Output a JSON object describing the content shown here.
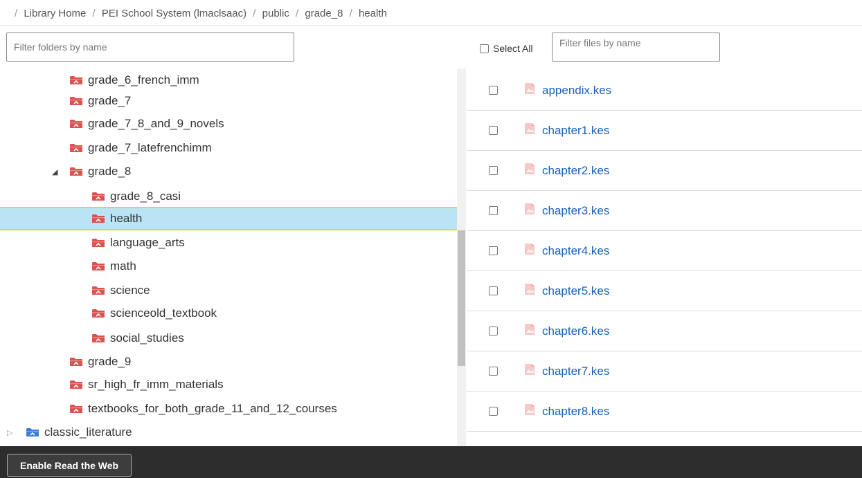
{
  "breadcrumb": {
    "items": [
      "Library Home",
      "PEI School System (lmaclsaac)",
      "public",
      "grade_8",
      "health"
    ],
    "separator": "/"
  },
  "folder_filter": {
    "placeholder": "Filter folders by name",
    "value": ""
  },
  "select_all": {
    "label": "Select All",
    "checked": false
  },
  "file_filter": {
    "placeholder": "Filter files by name",
    "value": ""
  },
  "folder_tree": [
    {
      "label": "grade_6_french_imm",
      "icon": "red-folder-icon"
    },
    {
      "label": "grade_7",
      "icon": "red-folder-icon"
    },
    {
      "label": "grade_7_8_and_9_novels",
      "icon": "red-folder-icon"
    },
    {
      "label": "grade_7_latefrenchimm",
      "icon": "red-folder-icon"
    },
    {
      "label": "grade_8",
      "icon": "red-folder-icon",
      "expanded": true
    },
    {
      "label": "grade_8_casi",
      "icon": "red-folder-icon"
    },
    {
      "label": "health",
      "icon": "red-folder-icon",
      "selected": true
    },
    {
      "label": "language_arts",
      "icon": "red-folder-icon"
    },
    {
      "label": "math",
      "icon": "red-folder-icon"
    },
    {
      "label": "science",
      "icon": "red-folder-icon"
    },
    {
      "label": "scienceold_textbook",
      "icon": "red-folder-icon"
    },
    {
      "label": "social_studies",
      "icon": "red-folder-icon"
    },
    {
      "label": "grade_9",
      "icon": "red-folder-icon"
    },
    {
      "label": "sr_high_fr_imm_materials",
      "icon": "red-folder-icon"
    },
    {
      "label": "textbooks_for_both_grade_11_and_12_courses",
      "icon": "red-folder-icon"
    },
    {
      "label": "classic_literature",
      "icon": "blue-folder-icon",
      "expanded": false
    }
  ],
  "files": [
    {
      "name": "appendix.kes",
      "checked": false
    },
    {
      "name": "chapter1.kes",
      "checked": false
    },
    {
      "name": "chapter2.kes",
      "checked": false
    },
    {
      "name": "chapter3.kes",
      "checked": false
    },
    {
      "name": "chapter4.kes",
      "checked": false
    },
    {
      "name": "chapter5.kes",
      "checked": false
    },
    {
      "name": "chapter6.kes",
      "checked": false
    },
    {
      "name": "chapter7.kes",
      "checked": false
    },
    {
      "name": "chapter8.kes",
      "checked": false
    }
  ],
  "bottom_bar": {
    "read_the_web_label": "Enable Read the Web"
  },
  "colors": {
    "link": "#1a5fb4",
    "selected_row_bg": "#b8e4f6",
    "selected_row_border": "#f1d600",
    "red_folder": "#d9534f",
    "blue_folder": "#3b7dd8",
    "bottom_bar_bg": "#2d2d2d"
  }
}
